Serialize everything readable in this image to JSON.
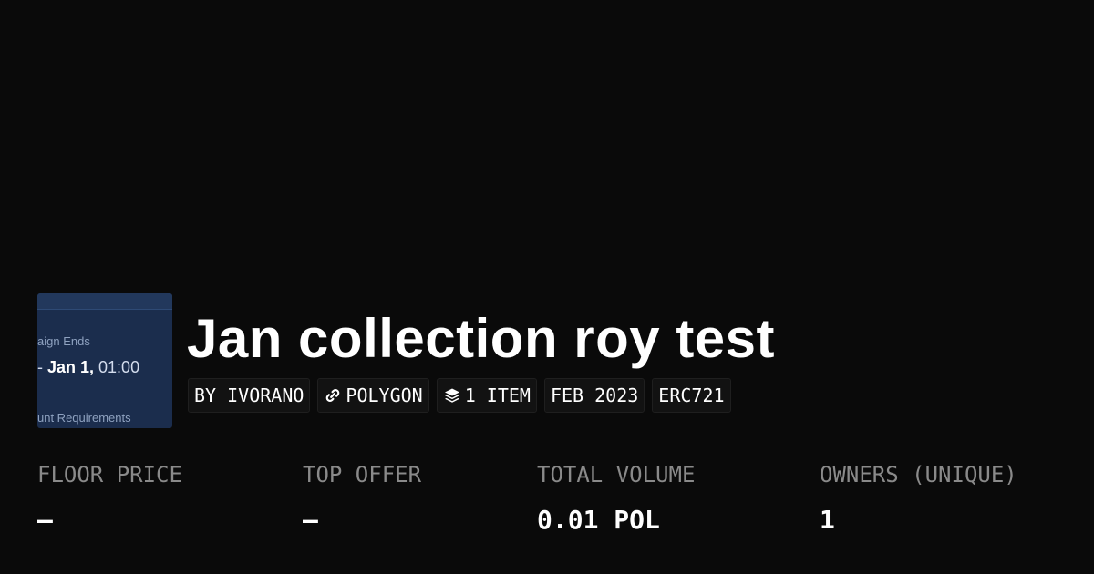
{
  "collection": {
    "title": "Jan collection roy test",
    "thumbnail": {
      "line1": "aign Ends",
      "line2_prefix": "- ",
      "line2_date": "Jan 1,",
      "line2_time": " 01:00",
      "line3": "unt Requirements"
    },
    "tags": {
      "creator": "BY IVORANO",
      "chain": "POLYGON",
      "chain_icon": "link-icon",
      "items": "1 ITEM",
      "items_icon": "layers-icon",
      "date": "FEB 2023",
      "standard": "ERC721"
    }
  },
  "stats": {
    "floor_price": {
      "label": "FLOOR PRICE",
      "value": "–"
    },
    "top_offer": {
      "label": "TOP OFFER",
      "value": "–"
    },
    "total_volume": {
      "label": "TOTAL VOLUME",
      "value": "0.01 POL"
    },
    "owners": {
      "label": "OWNERS (UNIQUE)",
      "value": "1"
    }
  },
  "colors": {
    "background": "#0a0a0a",
    "text": "#ffffff",
    "muted": "#8a8a8a",
    "tag_background": "#121212",
    "thumbnail_background": "#1b2d4d"
  }
}
